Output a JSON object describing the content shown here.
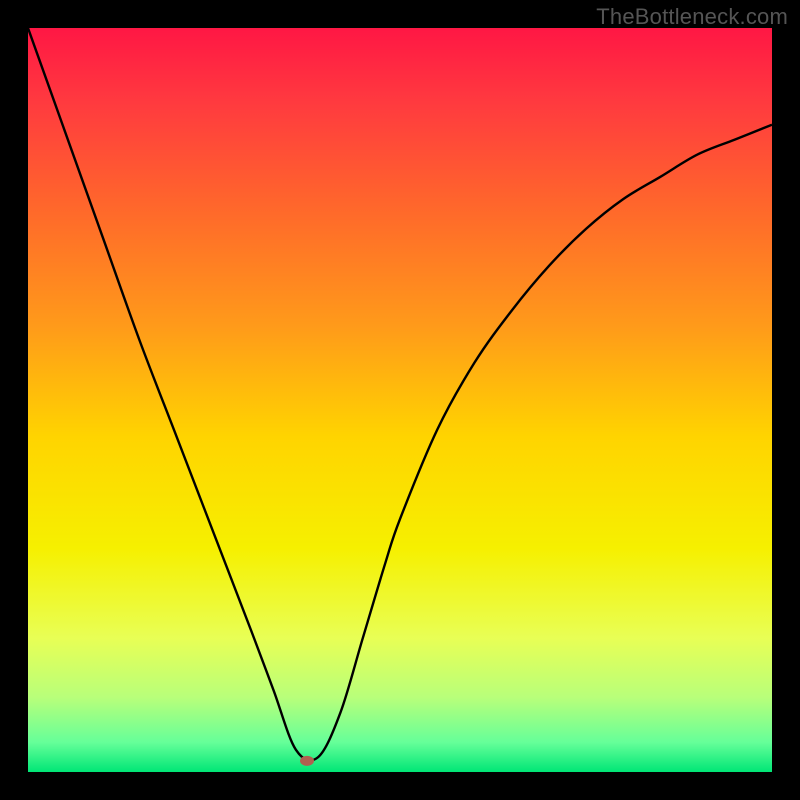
{
  "watermark": "TheBottleneck.com",
  "chart_data": {
    "type": "line",
    "title": "",
    "xlabel": "",
    "ylabel": "",
    "xlim": [
      0,
      100
    ],
    "ylim": [
      0,
      100
    ],
    "series": [
      {
        "name": "curve",
        "x": [
          0,
          5,
          10,
          15,
          20,
          25,
          30,
          33,
          36,
          39,
          42,
          45,
          48,
          50,
          55,
          60,
          65,
          70,
          75,
          80,
          85,
          90,
          95,
          100
        ],
        "y": [
          100,
          86,
          72,
          58,
          45,
          32,
          19,
          11,
          3,
          2,
          8,
          18,
          28,
          34,
          46,
          55,
          62,
          68,
          73,
          77,
          80,
          83,
          85,
          87
        ]
      }
    ],
    "marker": {
      "x": 37.5,
      "y": 1.5,
      "color": "#b06050"
    },
    "gradient_stops": [
      {
        "offset": 0.0,
        "color": "#ff1744"
      },
      {
        "offset": 0.1,
        "color": "#ff3a3f"
      },
      {
        "offset": 0.25,
        "color": "#ff6a2a"
      },
      {
        "offset": 0.4,
        "color": "#ff9a1a"
      },
      {
        "offset": 0.55,
        "color": "#ffd400"
      },
      {
        "offset": 0.7,
        "color": "#f6f000"
      },
      {
        "offset": 0.82,
        "color": "#e8ff55"
      },
      {
        "offset": 0.9,
        "color": "#b8ff7a"
      },
      {
        "offset": 0.96,
        "color": "#66ff99"
      },
      {
        "offset": 1.0,
        "color": "#00e676"
      }
    ]
  }
}
